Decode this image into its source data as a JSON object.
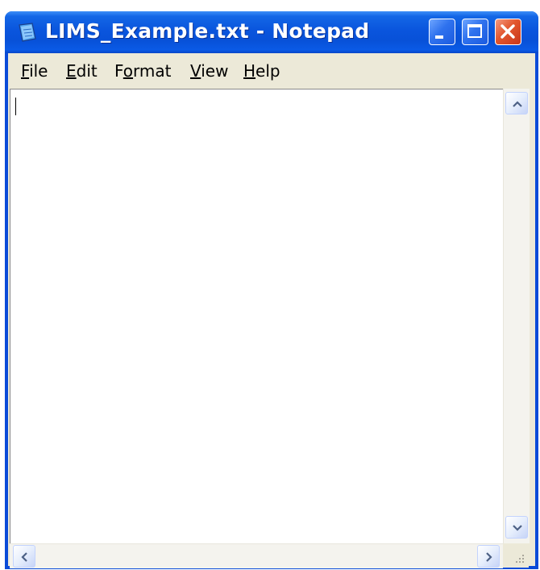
{
  "window": {
    "title": "LIMS_Example.txt - Notepad",
    "app_icon": "notepad-icon",
    "controls": {
      "minimize_icon": "minimize-icon",
      "maximize_icon": "maximize-icon",
      "close_icon": "close-icon"
    },
    "colors": {
      "titlebar": "#0a55dd",
      "close_button": "#e2562e",
      "menubar": "#ece9d8",
      "editor_background": "#ffffff"
    }
  },
  "menubar": {
    "items": [
      {
        "label_rest": "ile",
        "mnemonic": "F"
      },
      {
        "label_rest": "dit",
        "mnemonic": "E"
      },
      {
        "label_pre": "F",
        "mnemonic": "o",
        "label_rest": "rmat"
      },
      {
        "label_rest": "iew",
        "mnemonic": "V"
      },
      {
        "label_rest": "elp",
        "mnemonic": "H"
      }
    ]
  },
  "editor": {
    "content": ""
  },
  "scrollbars": {
    "up_icon": "chevron-up-icon",
    "down_icon": "chevron-down-icon",
    "left_icon": "chevron-left-icon",
    "right_icon": "chevron-right-icon",
    "grip_icon": "size-grip-icon"
  }
}
